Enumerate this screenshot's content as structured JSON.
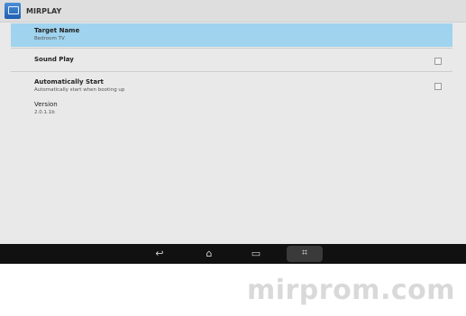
{
  "app": {
    "title": "MIRPLAY",
    "icon": "cast-screen-icon"
  },
  "settings": [
    {
      "title": "Target Name",
      "summary": "Bedroom TV",
      "checkbox": false,
      "selected": true
    },
    {
      "title": "Sound Play",
      "summary": "",
      "checkbox": true,
      "checked": false
    },
    {
      "title": "Automatically Start",
      "summary": "Automatically start when booting up",
      "checkbox": true,
      "checked": false
    },
    {
      "title": "Version",
      "summary": "2.0.1.1b",
      "checkbox": false
    }
  ],
  "navbar": {
    "buttons": [
      {
        "name": "back-icon",
        "glyph": "↩"
      },
      {
        "name": "home-icon",
        "glyph": "⌂"
      },
      {
        "name": "recent-apps-icon",
        "glyph": "▭"
      },
      {
        "name": "screenshot-icon",
        "glyph": "⌗"
      }
    ]
  },
  "watermark": "mirprom.com"
}
